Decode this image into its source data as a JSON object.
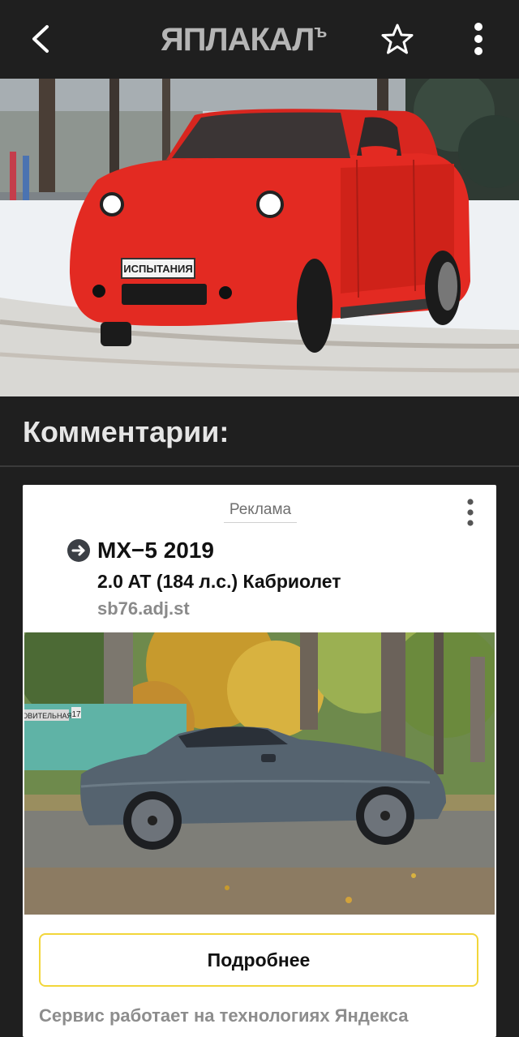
{
  "header": {
    "logo_text": "ЯПЛАКАЛ",
    "logo_suffix": "ъ",
    "back_icon": "chevron-left-icon",
    "star_icon": "star-outline-icon",
    "more_icon": "more-vertical-icon"
  },
  "hero": {
    "plate_text": "ИСПЫТАНИЯ"
  },
  "comments": {
    "title": "Комментарии:"
  },
  "ad": {
    "label": "Реклама",
    "title": "MX−5 2019",
    "subtitle": "2.0 AT (184 л.с.) Кабриолет",
    "domain": "sb76.adj.st",
    "street_sign": "ЮВИТЕЛЬНАЯ",
    "house_number": "17",
    "button_label": "Подробнее",
    "footer": "Сервис работает на технологиях Яндекса",
    "accent_color": "#f2d63a"
  },
  "colors": {
    "background": "#1f1f1f",
    "title_text": "#e6e6e6",
    "car_red": "#e32a22"
  }
}
